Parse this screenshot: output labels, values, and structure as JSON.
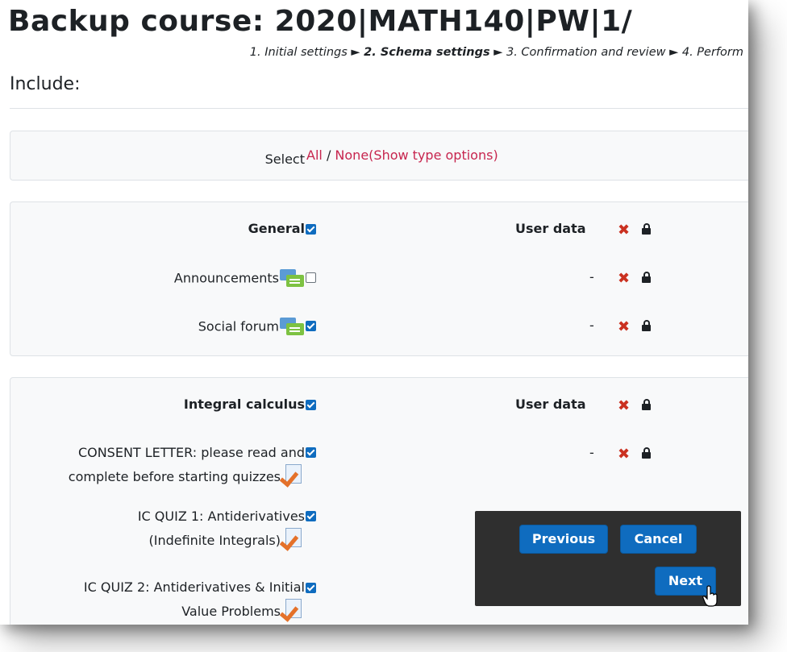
{
  "page": {
    "title": "Backup course: 2020|MATH140|PW|1/",
    "breadcrumb": {
      "step1": "1. Initial settings",
      "sep": "►",
      "step2": "2. Schema settings",
      "step3": "3. Confirmation and review",
      "step4": "4. Perform"
    },
    "include_label": "Include:"
  },
  "select_row": {
    "label": "Select",
    "all": "All",
    "slash": "/",
    "none": "None",
    "open_paren": "(",
    "show_type_options": "Show type options",
    "close_paren": ")"
  },
  "sections": [
    {
      "name": "General",
      "checked": true,
      "user_data_label": "User data",
      "items": [
        {
          "label": "Announcements",
          "icon": "forum-icon",
          "checked": false,
          "user_data": "-"
        },
        {
          "label": "Social forum",
          "icon": "forum-icon",
          "checked": true,
          "user_data": "-"
        }
      ]
    },
    {
      "name": "Integral calculus",
      "checked": true,
      "user_data_label": "User data",
      "items": [
        {
          "label_line1": "CONSENT LETTER: please read and",
          "label_line2": "complete before starting quizzes",
          "icon": "quiz-icon",
          "checked": true,
          "user_data": "-"
        },
        {
          "label_line1": "IC QUIZ 1: Antiderivatives",
          "label_line2": "(Indefinite Integrals)",
          "icon": "quiz-icon",
          "checked": true
        },
        {
          "label_line1": "IC QUIZ 2: Antiderivatives & Initial",
          "label_line2": "Value Problems",
          "icon": "quiz-icon",
          "checked": true
        }
      ]
    }
  ],
  "status_icons": {
    "excluded": "x-icon",
    "locked": "lock-icon",
    "x_glyph": "✖"
  },
  "buttons": {
    "previous": "Previous",
    "cancel": "Cancel",
    "next": "Next"
  },
  "colors": {
    "primary": "#0f6cbf",
    "link": "#c7254e",
    "cross": "#ca3120",
    "dock": "#2f2f2f"
  }
}
